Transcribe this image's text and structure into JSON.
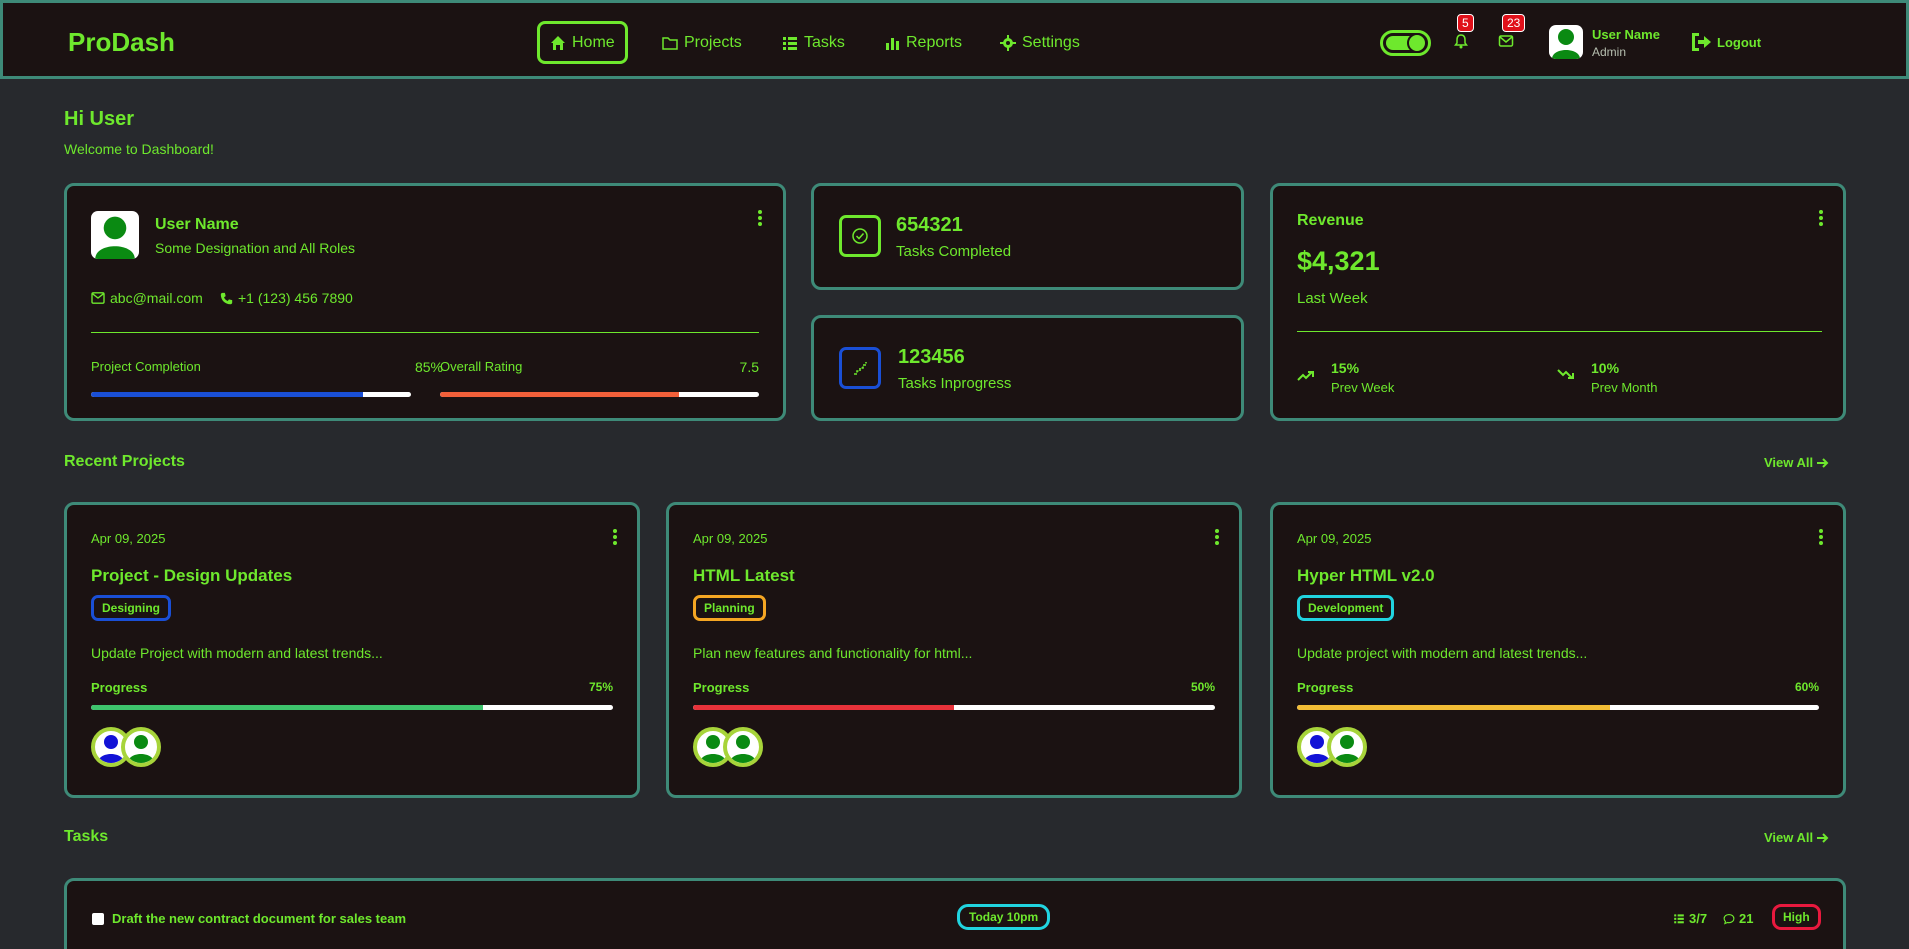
{
  "nav": {
    "brand": "ProDash",
    "items": [
      {
        "label": "Home",
        "icon": "home-icon",
        "active": true
      },
      {
        "label": "Projects",
        "icon": "folder-icon"
      },
      {
        "label": "Tasks",
        "icon": "list-icon"
      },
      {
        "label": "Reports",
        "icon": "bar-chart-icon"
      },
      {
        "label": "Settings",
        "icon": "gear-icon"
      }
    ],
    "notifications_count": "5",
    "messages_count": "23",
    "user_name": "User Name",
    "user_role": "Admin",
    "logout_label": "Logout"
  },
  "greeting": {
    "title": "Hi User",
    "subtitle": "Welcome to Dashboard!"
  },
  "profile": {
    "name": "User Name",
    "designation": "Some Designation and All Roles",
    "email": "abc@mail.com",
    "phone": "+1 (123) 456 7890",
    "completion_label": "Project Completion",
    "completion_value": "85%",
    "completion_fraction": 0.85,
    "rating_label": "Overall Rating",
    "rating_value": "7.5",
    "rating_fraction": 0.75
  },
  "stats": {
    "completed_value": "654321",
    "completed_label": "Tasks Completed",
    "inprogress_value": "123456",
    "inprogress_label": "Tasks Inprogress"
  },
  "revenue": {
    "title": "Revenue",
    "amount": "$4,321",
    "period": "Last Week",
    "prev_week_value": "15%",
    "prev_week_label": "Prev Week",
    "prev_month_value": "10%",
    "prev_month_label": "Prev Month"
  },
  "recent_projects": {
    "title": "Recent Projects",
    "view_all": "View All",
    "items": [
      {
        "date": "Apr 09, 2025",
        "title": "Project - Design Updates",
        "tag": "Designing",
        "tag_color": "#1a4fd6",
        "desc": "Update Project with modern and latest trends...",
        "progress_label": "Progress",
        "progress": "75%",
        "progress_fraction": 0.75,
        "bar_color": "#3ec46d"
      },
      {
        "date": "Apr 09, 2025",
        "title": "HTML Latest",
        "tag": "Planning",
        "tag_color": "#f5a623",
        "desc": "Plan new features and functionality for html...",
        "progress_label": "Progress",
        "progress": "50%",
        "progress_fraction": 0.5,
        "bar_color": "#e8323a"
      },
      {
        "date": "Apr 09, 2025",
        "title": "Hyper HTML v2.0",
        "tag": "Development",
        "tag_color": "#21d4e0",
        "desc": "Update project with modern and latest trends...",
        "progress_label": "Progress",
        "progress": "60%",
        "progress_fraction": 0.6,
        "bar_color": "#f2bd35"
      }
    ]
  },
  "tasks": {
    "title": "Tasks",
    "view_all": "View All",
    "items": [
      {
        "label": "Draft the new contract document for sales team",
        "due": "Today 10pm",
        "subtasks": "3/7",
        "comments": "21",
        "priority": "High"
      }
    ]
  },
  "colors": {
    "accent": "#6ee82d",
    "card_bg": "#1b1212",
    "border": "#3e8a78",
    "page_bg": "#27292d"
  }
}
